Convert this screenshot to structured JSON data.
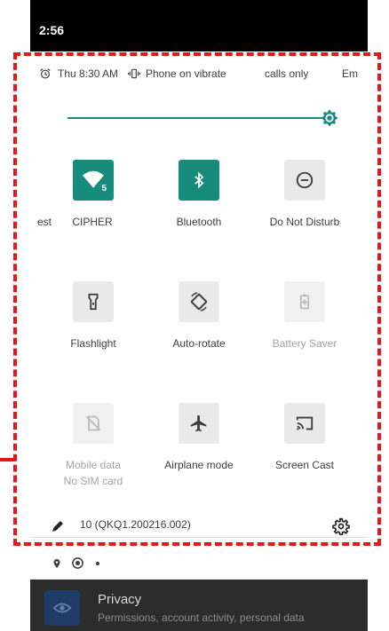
{
  "status_bar": {
    "time": "2:56"
  },
  "alarm_row": {
    "alarm_icon": "alarm-clock-icon",
    "alarm_text": "Thu 8:30 AM",
    "vibrate_icon": "vibrate-icon",
    "vibrate_text": "Phone on vibrate",
    "calls_text": "calls only",
    "emergency_text": "Em"
  },
  "brightness": {
    "level_percent": 100,
    "thumb_icon": "brightness-icon",
    "accent": "#178c7c"
  },
  "tiles": [
    {
      "label_left": "est",
      "label": "CIPHER",
      "icon": "wifi-icon",
      "badge": "5",
      "state": "on"
    },
    {
      "label": "Bluetooth",
      "icon": "bluetooth-icon",
      "state": "on"
    },
    {
      "label": "Do Not Disturb",
      "icon": "do-not-disturb-icon",
      "state": "off"
    },
    {
      "label": "Flashlight",
      "icon": "flashlight-icon",
      "state": "off"
    },
    {
      "label": "Auto-rotate",
      "icon": "auto-rotate-icon",
      "state": "off"
    },
    {
      "label": "Battery Saver",
      "icon": "battery-saver-icon",
      "state": "unavailable"
    },
    {
      "label": "Mobile data",
      "sublabel": "No SIM card",
      "icon": "no-sim-icon",
      "state": "unavailable"
    },
    {
      "label": "Airplane mode",
      "icon": "airplane-icon",
      "state": "off"
    },
    {
      "label": "Screen Cast",
      "icon": "cast-icon",
      "state": "off"
    }
  ],
  "footer": {
    "edit_icon": "pencil-icon",
    "build": "10 (QKQ1.200216.002)",
    "settings_icon": "gear-icon"
  },
  "notification_strip": {
    "icons": [
      "location-icon",
      "data-saver-icon",
      "dot-icon"
    ]
  },
  "background_app": {
    "title": "Privacy",
    "subtitle": "Permissions, account activity, personal data",
    "icon": "privacy-eye-icon"
  },
  "colors": {
    "accent": "#178c7c",
    "callout": "#e8161b"
  }
}
